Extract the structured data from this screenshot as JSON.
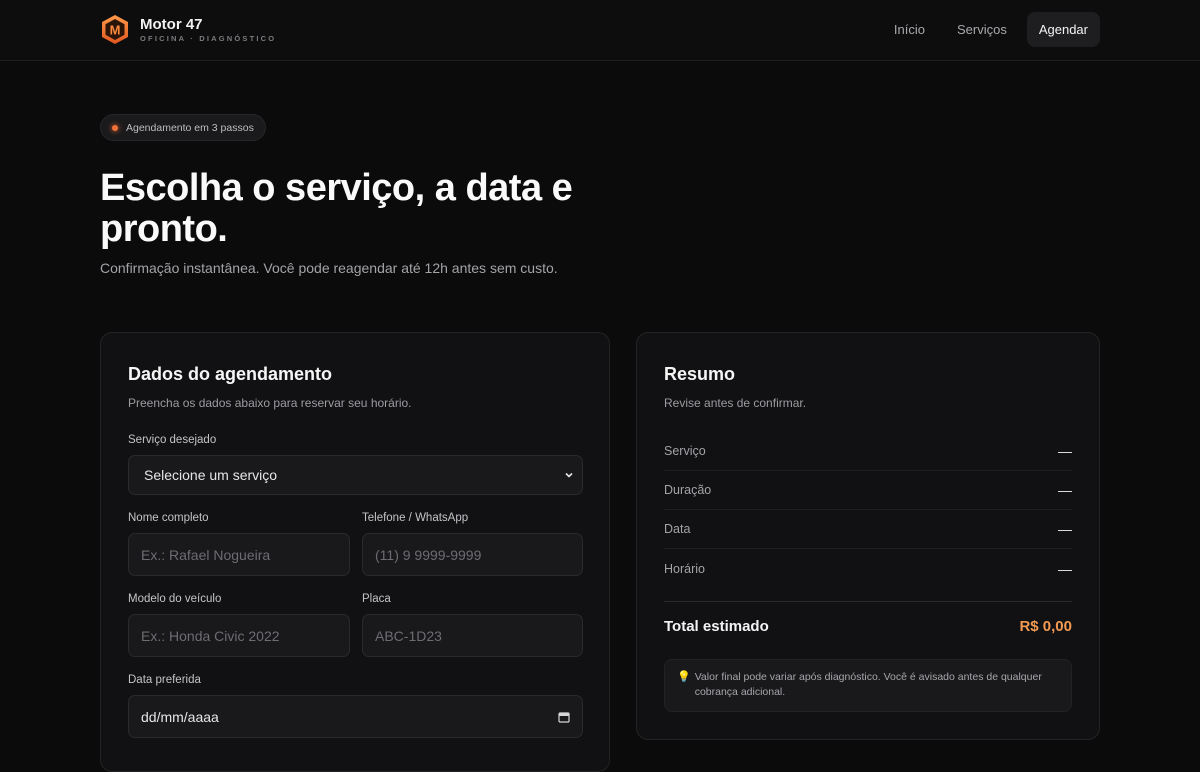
{
  "brand": {
    "name": "Motor 47",
    "tagline": "OFICINA · DIAGNÓSTICO",
    "logo_letter": "M",
    "accent": "#f0703a"
  },
  "nav": {
    "items": [
      "Início",
      "Serviços",
      "Agendar"
    ],
    "active": "Agendar"
  },
  "hero": {
    "badge": "Agendamento em 3 passos",
    "title": "Escolha o serviço, a data e pronto.",
    "subtitle": "Confirmação instantânea. Você pode reagendar até 12h antes sem custo."
  },
  "form": {
    "title": "Dados do agendamento",
    "subtitle": "Preencha os dados abaixo para reservar seu horário.",
    "service_label": "Serviço desejado",
    "service_value": "Selecione um serviço",
    "name_label": "Nome completo",
    "name_placeholder": "Ex.: Rafael Nogueira",
    "phone_label": "Telefone / WhatsApp",
    "phone_placeholder": "(11) 9 9999-9999",
    "vehicle_label": "Modelo do veículo",
    "vehicle_placeholder": "Ex.: Honda Civic 2022",
    "plate_label": "Placa",
    "plate_placeholder": "ABC-1D23",
    "date_label": "Data preferida",
    "date_value": "dd/mm/aaaa"
  },
  "summary": {
    "title": "Resumo",
    "subtitle": "Revise antes de confirmar.",
    "rows": [
      {
        "label": "Serviço",
        "value": "—"
      },
      {
        "label": "Duração",
        "value": "—"
      },
      {
        "label": "Data",
        "value": "—"
      },
      {
        "label": "Horário",
        "value": "—"
      }
    ],
    "total_label": "Total estimado",
    "total_value": "R$ 0,00",
    "total_color": "#f29a52",
    "note_icon": "lightbulb-icon",
    "note": "Valor final pode variar após diagnóstico. Você é avisado antes de qualquer cobrança adicional."
  }
}
